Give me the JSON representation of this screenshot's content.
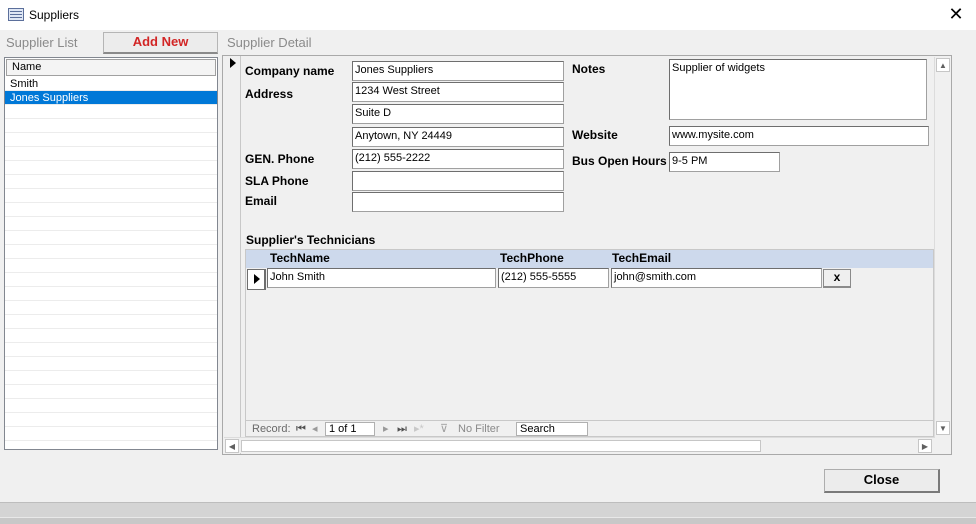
{
  "window": {
    "title": "Suppliers",
    "close_glyph": "✕"
  },
  "tabs": {
    "supplier_list": "Supplier List",
    "add_new": "Add New",
    "supplier_detail": "Supplier Detail"
  },
  "list": {
    "header": "Name",
    "rows": [
      "Smith",
      "Jones Suppliers"
    ],
    "selected_index": 1
  },
  "form": {
    "labels": {
      "company_name": "Company name",
      "address": "Address",
      "gen_phone": "GEN. Phone",
      "sla_phone": "SLA Phone",
      "email": "Email",
      "notes": "Notes",
      "website": "Website",
      "bus_open_hours": "Bus Open Hours"
    },
    "values": {
      "company_name": "Jones Suppliers",
      "address1": "1234 West Street",
      "address2": "Suite D",
      "address3": "Anytown, NY 24449",
      "gen_phone": "(212) 555-2222",
      "sla_phone": "",
      "email": "",
      "notes": "Supplier of widgets",
      "website": "www.mysite.com",
      "bus_open_hours": "9-5 PM"
    }
  },
  "technicians": {
    "caption": "Supplier's Technicians",
    "columns": [
      "TechName",
      "TechPhone",
      "TechEmail"
    ],
    "rows": [
      {
        "name": "John Smith",
        "phone": "(212) 555-5555",
        "email": "john@smith.com",
        "delete_label": "x"
      }
    ],
    "nav": {
      "record_label": "Record:",
      "position": "1 of 1",
      "filter": "No Filter",
      "search_placeholder": "Search"
    }
  },
  "footer": {
    "close_label": "Close"
  },
  "colors": {
    "accent_red": "#d22525",
    "selection_blue": "#0078d7",
    "subform_header": "#cdd9ec"
  }
}
